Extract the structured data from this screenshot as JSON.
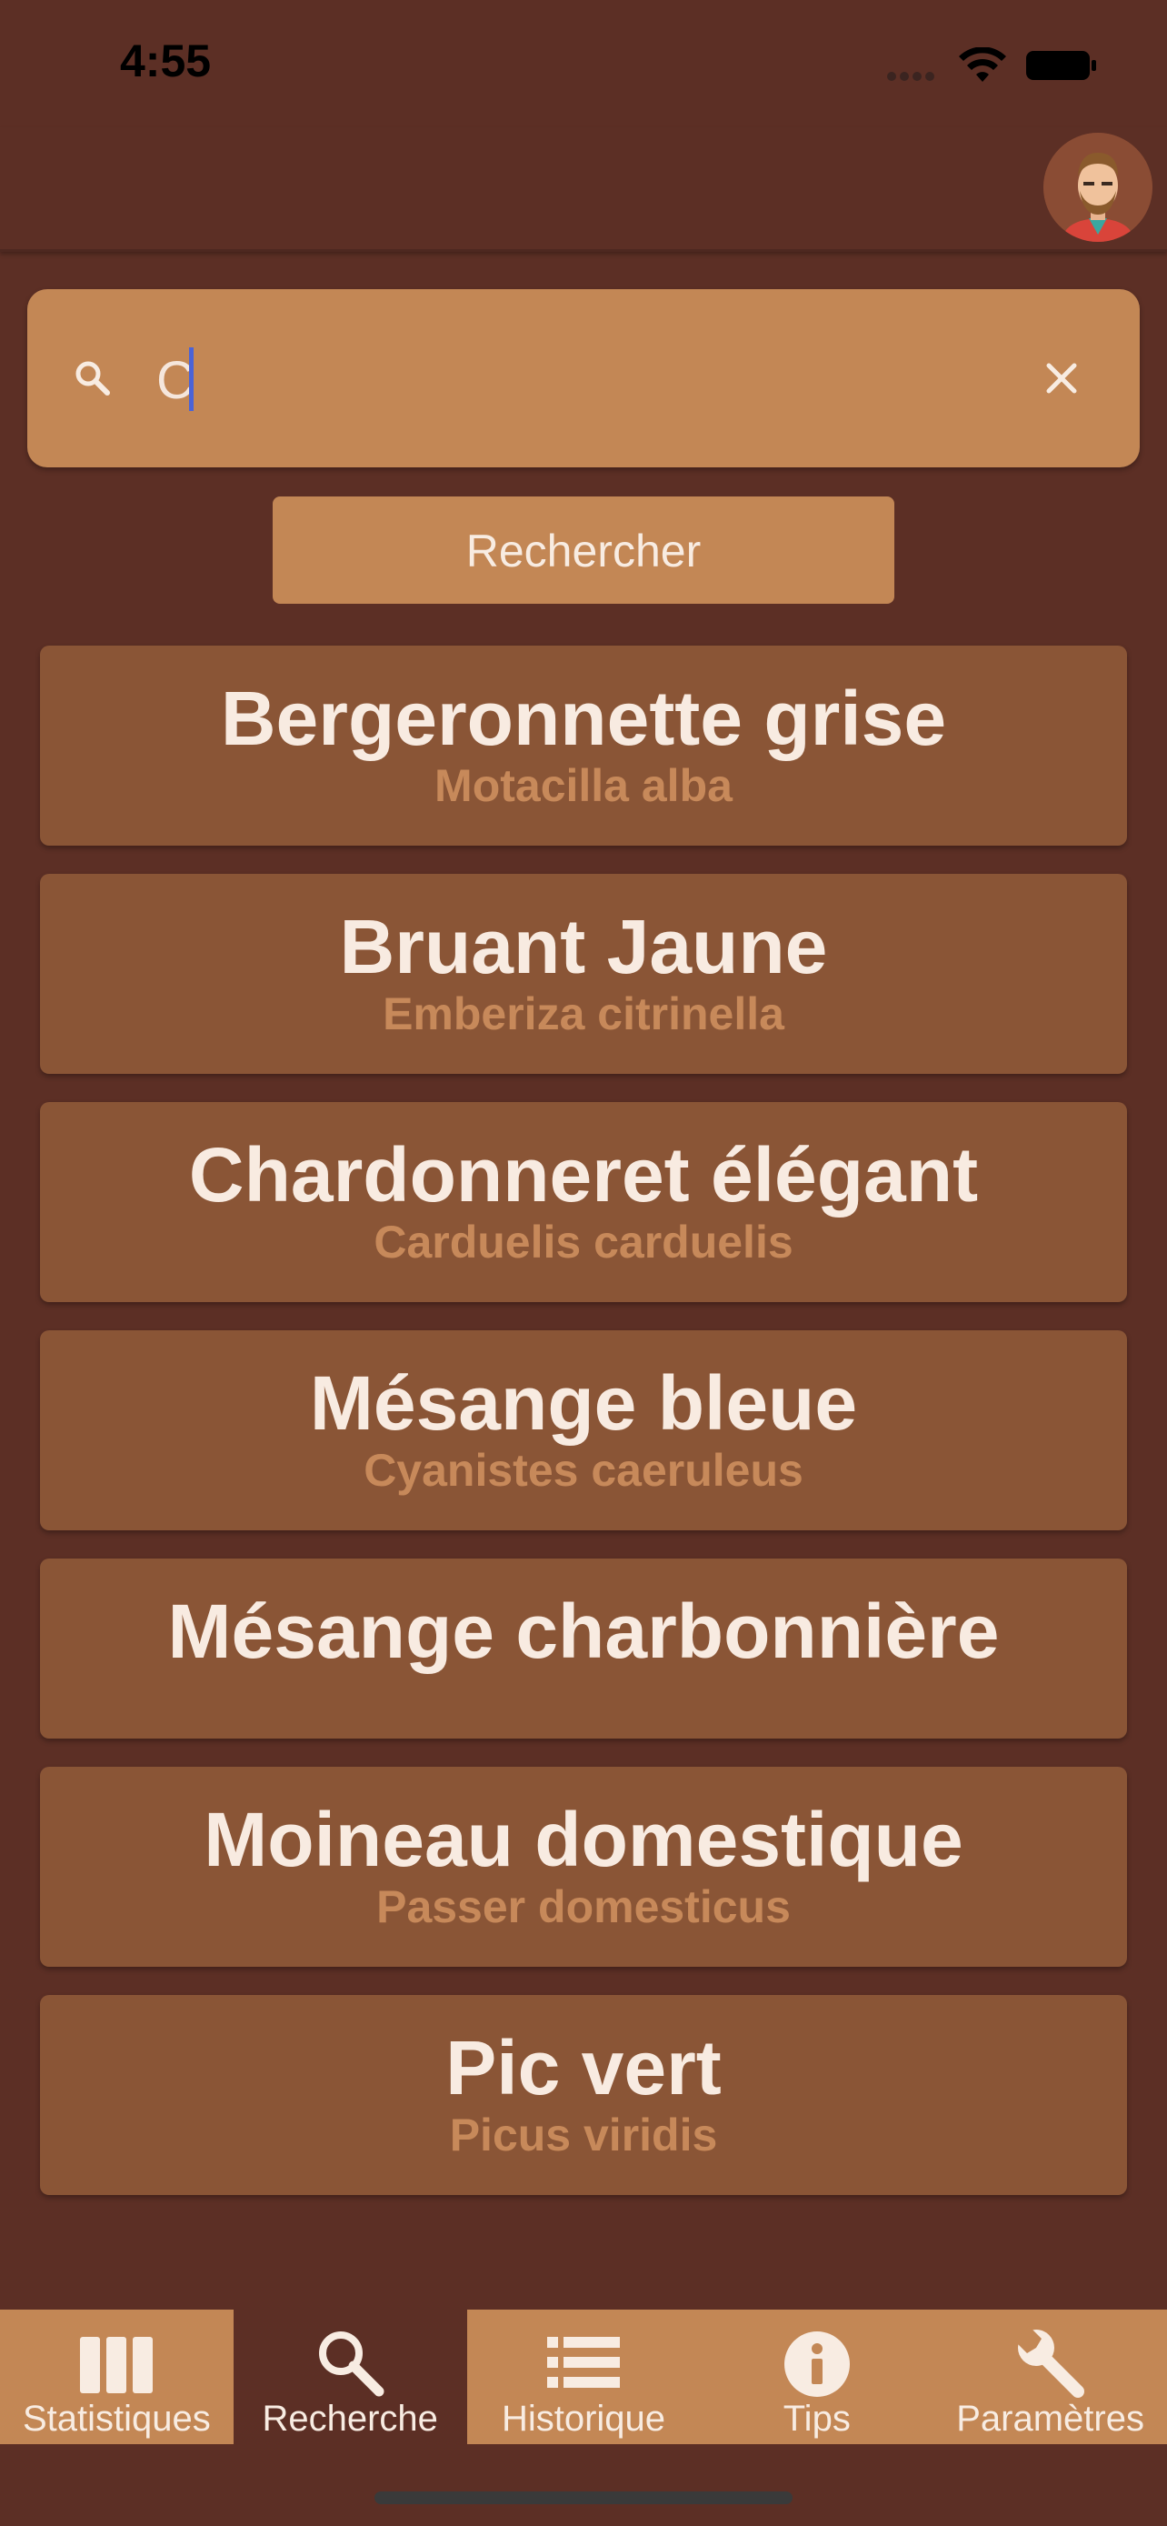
{
  "status_bar": {
    "time": "4:55"
  },
  "search": {
    "value": "C",
    "button_label": "Rechercher"
  },
  "results": [
    {
      "name": "Bergeronnette grise",
      "latin": "Motacilla alba"
    },
    {
      "name": "Bruant Jaune",
      "latin": "Emberiza citrinella"
    },
    {
      "name": "Chardonneret élégant",
      "latin": "Carduelis carduelis"
    },
    {
      "name": "Mésange bleue",
      "latin": "Cyanistes caeruleus"
    },
    {
      "name": "Mésange charbonnière",
      "latin": ""
    },
    {
      "name": "Moineau domestique",
      "latin": "Passer domesticus"
    },
    {
      "name": "Pic vert",
      "latin": "Picus viridis"
    }
  ],
  "tabs": [
    {
      "label": "Statistiques",
      "icon": "columns-icon"
    },
    {
      "label": "Recherche",
      "icon": "search-icon",
      "active": true
    },
    {
      "label": "Historique",
      "icon": "list-icon"
    },
    {
      "label": "Tips",
      "icon": "info-icon"
    },
    {
      "label": "Paramètres",
      "icon": "wrench-icon"
    }
  ],
  "colors": {
    "background": "#5c2f25",
    "accent": "#c38755",
    "card": "#8a5536",
    "card_title": "#f8ebe1",
    "card_subtitle": "#c7895a"
  }
}
